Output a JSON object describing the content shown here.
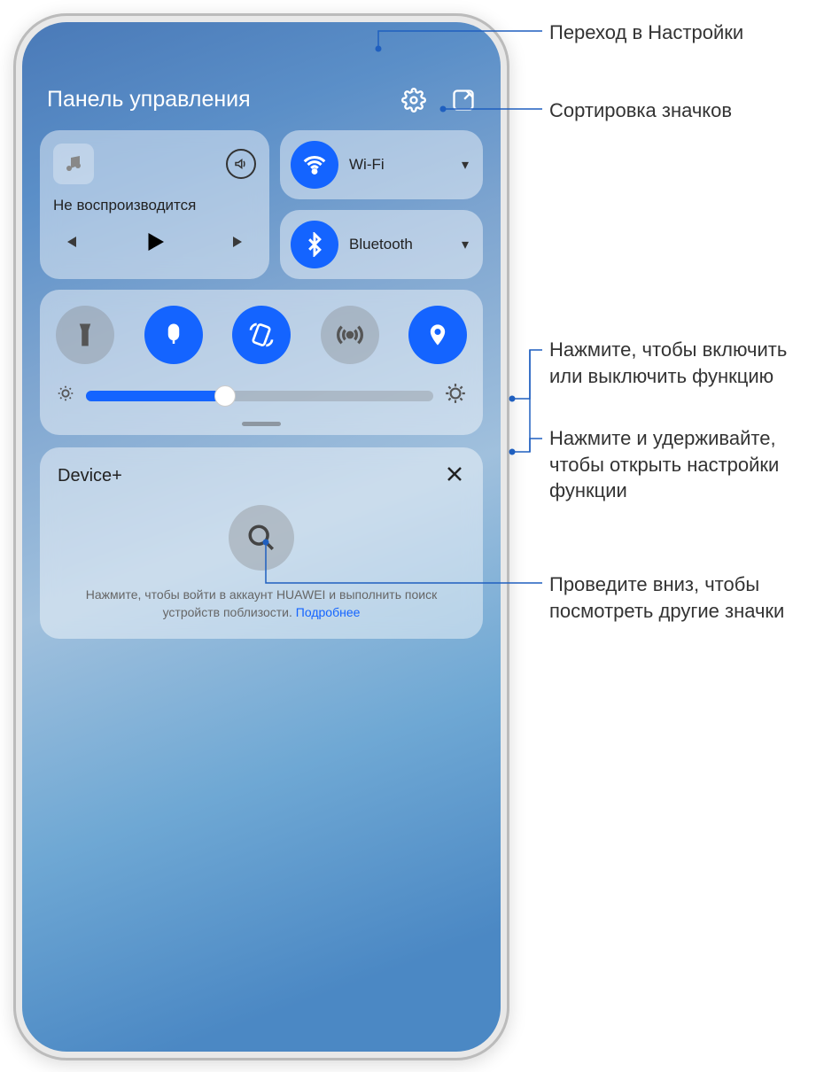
{
  "header": {
    "title": "Панель управления"
  },
  "media": {
    "status": "Не воспроизводится"
  },
  "conn": {
    "wifi_label": "Wi-Fi",
    "bluetooth_label": "Bluetooth"
  },
  "brightness": {
    "value_percent": 40
  },
  "device": {
    "title": "Device+",
    "hint_text": "Нажмите, чтобы войти в аккаунт HUAWEI и выполнить поиск устройств поблизости. ",
    "hint_link": "Подробнее"
  },
  "annotations": {
    "settings": "Переход в Настройки",
    "sort": "Сортировка значков",
    "tap": "Нажмите, чтобы включить или выключить функцию",
    "hold": "Нажмите и удерживайте, чтобы открыть настройки функции",
    "swipe": "Проведите вниз, чтобы посмотреть другие значки"
  }
}
